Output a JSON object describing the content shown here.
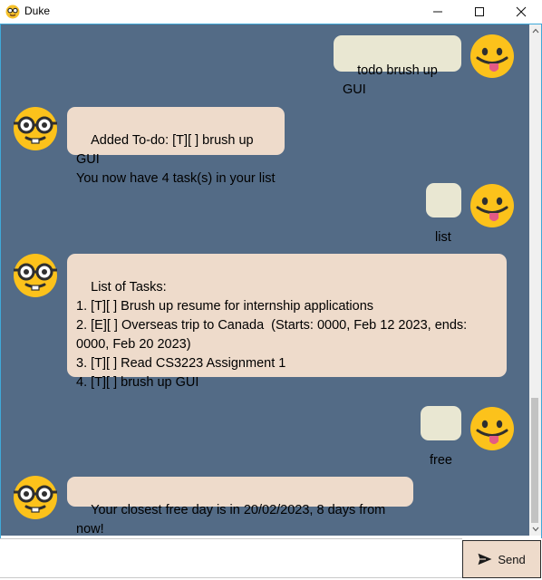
{
  "window": {
    "title": "Duke",
    "icons": [
      "app-icon",
      "minimize-icon",
      "maximize-icon",
      "close-icon"
    ]
  },
  "messages": [
    {
      "sender": "user",
      "text": "todo brush up GUI",
      "avatar": "tongue-emoji"
    },
    {
      "sender": "duke",
      "text": "Added To-do: [T][ ] brush up GUI\nYou now have 4 task(s) in your list",
      "avatar": "nerd-emoji"
    },
    {
      "sender": "user",
      "text": "list",
      "avatar": "tongue-emoji"
    },
    {
      "sender": "duke",
      "text": "List of Tasks:\n1. [T][ ] Brush up resume for internship applications\n2. [E][ ] Overseas trip to Canada  (Starts: 0000, Feb 12 2023, ends: 0000, Feb 20 2023)\n3. [T][ ] Read CS3223 Assignment 1\n4. [T][ ] brush up GUI",
      "avatar": "nerd-emoji"
    },
    {
      "sender": "user",
      "text": "free",
      "avatar": "tongue-emoji"
    },
    {
      "sender": "duke",
      "text": "Your closest free day is in 20/02/2023, 8 days from now!",
      "avatar": "nerd-emoji"
    }
  ],
  "input": {
    "value": "",
    "placeholder": ""
  },
  "send_button": {
    "label": "Send",
    "icon": "send-icon"
  },
  "colors": {
    "chat_bg": "#536b86",
    "user_bubble": "#e9e7d2",
    "duke_bubble": "#eedbcb",
    "send_bg": "#eedbcb",
    "frame_accent": "#3fa9d9"
  }
}
